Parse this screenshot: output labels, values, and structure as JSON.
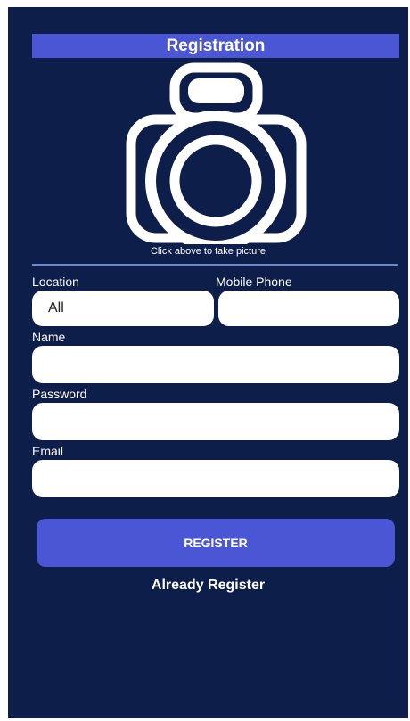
{
  "header": {
    "title": "Registration"
  },
  "camera": {
    "icon": "camera-icon",
    "caption": "Click above to take picture"
  },
  "form": {
    "location": {
      "label": "Location",
      "value": "All"
    },
    "mobile_phone": {
      "label": "Mobile Phone",
      "value": ""
    },
    "name": {
      "label": "Name",
      "value": ""
    },
    "password": {
      "label": "Password",
      "value": ""
    },
    "email": {
      "label": "Email",
      "value": ""
    }
  },
  "actions": {
    "register_label": "REGISTER",
    "already_register_label": "Already Register"
  },
  "colors": {
    "background": "#0e1e4b",
    "accent": "#4a56d4",
    "divider": "#6f88c8",
    "field": "#ffffff"
  }
}
